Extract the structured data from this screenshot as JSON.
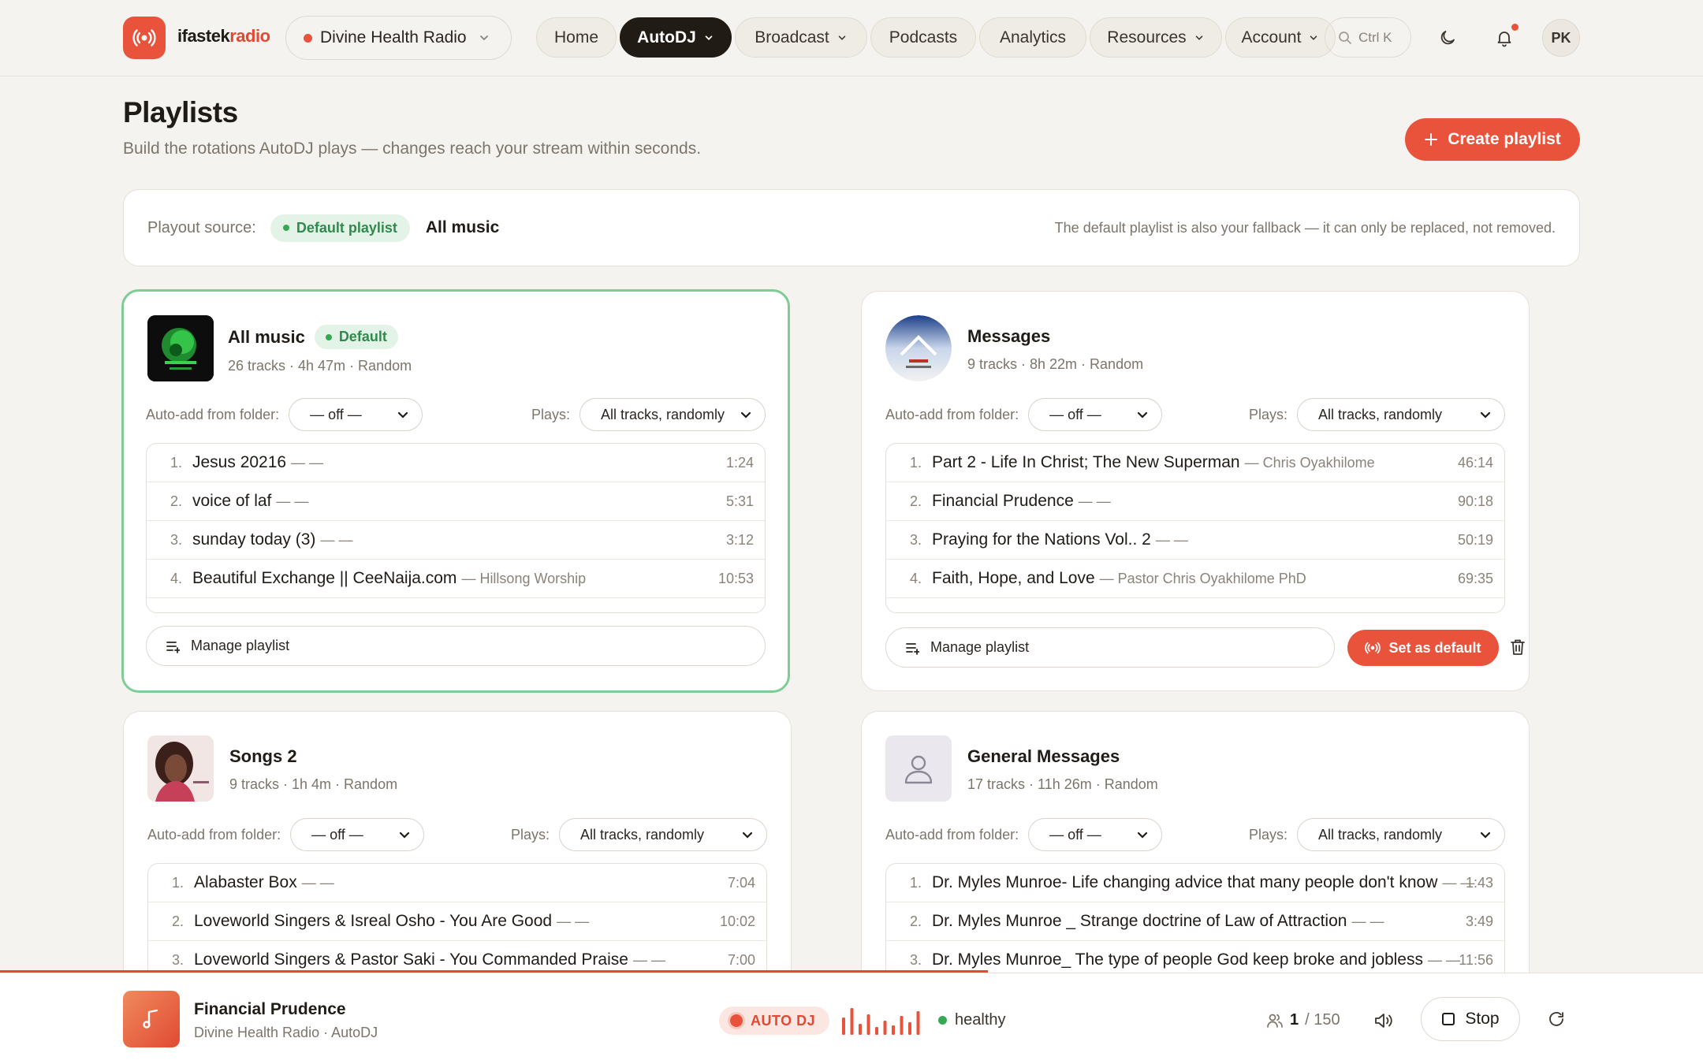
{
  "header": {
    "brand_prefix": "ifastek",
    "brand_suffix": "radio",
    "station": "Divine Health Radio",
    "nav": [
      "Home",
      "AutoDJ",
      "Broadcast",
      "Podcasts",
      "Analytics",
      "Resources",
      "Account"
    ],
    "search_shortcut": "Ctrl K",
    "avatar_initials": "PK"
  },
  "page": {
    "title": "Playlists",
    "subtitle": "Build the rotations AutoDJ plays — changes reach your stream within seconds.",
    "create_label": "Create playlist"
  },
  "source": {
    "label": "Playout source:",
    "badge": "Default playlist",
    "name": "All music",
    "note": "The default playlist is also your fallback — it can only be replaced, not removed."
  },
  "labels": {
    "auto_add": "Auto-add from folder:",
    "plays": "Plays:",
    "folder_value": "— off —",
    "plays_value": "All tracks, randomly",
    "manage": "Manage playlist",
    "set_default": "Set as default",
    "default_badge": "Default"
  },
  "playlists": [
    {
      "name": "All music",
      "meta": "26 tracks · 4h 47m · Random",
      "tracks": [
        {
          "n": "1.",
          "title": "Jesus 20216",
          "artist": "— —",
          "dur": "1:24"
        },
        {
          "n": "2.",
          "title": "voice of laf",
          "artist": "— —",
          "dur": "5:31"
        },
        {
          "n": "3.",
          "title": "sunday today (3)",
          "artist": "— —",
          "dur": "3:12"
        },
        {
          "n": "4.",
          "title": "Beautiful Exchange || CeeNaija.com",
          "artist": "— Hillsong Worship",
          "dur": "10:53"
        }
      ]
    },
    {
      "name": "Messages",
      "meta": "9 tracks · 8h 22m · Random",
      "tracks": [
        {
          "n": "1.",
          "title": "Part 2 - Life In Christ; The New Superman",
          "artist": "— Chris Oyakhilome",
          "dur": "46:14"
        },
        {
          "n": "2.",
          "title": "Financial Prudence",
          "artist": "— —",
          "dur": "90:18"
        },
        {
          "n": "3.",
          "title": "Praying for the Nations Vol.. 2",
          "artist": "— —",
          "dur": "50:19"
        },
        {
          "n": "4.",
          "title": "Faith, Hope, and Love",
          "artist": "— Pastor Chris Oyakhilome PhD",
          "dur": "69:35"
        }
      ]
    },
    {
      "name": "Songs 2",
      "meta": "9 tracks · 1h 4m · Random",
      "tracks": [
        {
          "n": "1.",
          "title": "Alabaster Box",
          "artist": "— —",
          "dur": "7:04"
        },
        {
          "n": "2.",
          "title": "Loveworld Singers & Isreal Osho - You Are Good",
          "artist": "— —",
          "dur": "10:02"
        },
        {
          "n": "3.",
          "title": "Loveworld Singers & Pastor Saki - You Commanded Praise",
          "artist": "— —",
          "dur": "7:00"
        }
      ]
    },
    {
      "name": "General Messages",
      "meta": "17 tracks · 11h 26m · Random",
      "tracks": [
        {
          "n": "1.",
          "title": "Dr. Myles Munroe- Life changing advice that many people don't know",
          "artist": "— —",
          "dur": "1:43"
        },
        {
          "n": "2.",
          "title": "Dr. Myles Munroe _ Strange doctrine of Law of Attraction",
          "artist": "— —",
          "dur": "3:49"
        },
        {
          "n": "3.",
          "title": "Dr. Myles Munroe_ The type of people God keep broke and jobless",
          "artist": "— —",
          "dur": "11:56"
        }
      ]
    }
  ],
  "player": {
    "title": "Financial Prudence",
    "subtitle": "Divine Health Radio · AutoDJ",
    "mode": "AUTO DJ",
    "health": "healthy",
    "listeners": "1",
    "capacity": "/ 150",
    "stop_label": "Stop",
    "progress_fraction": 0.58
  },
  "colors": {
    "accent": "#e9533b",
    "success": "#34a853",
    "ink": "#211b15"
  }
}
